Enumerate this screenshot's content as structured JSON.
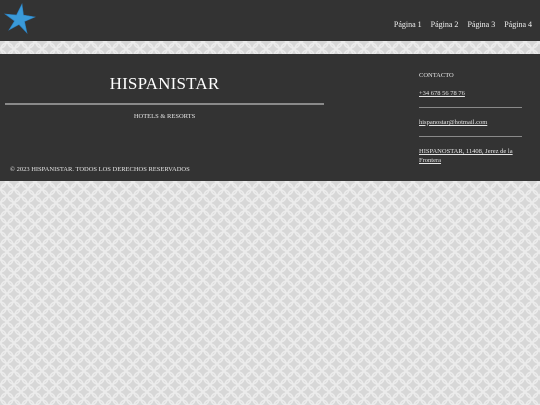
{
  "header": {
    "logo_icon": "blue-star-icon",
    "logo_color": "#3a9ad9",
    "nav": [
      {
        "label": "Página 1"
      },
      {
        "label": "Página 2"
      },
      {
        "label": "Página 3"
      },
      {
        "label": "Página 4"
      }
    ]
  },
  "footer": {
    "brand": {
      "title": "HISPANISTAR",
      "subtitle": "HOTELS & RESORTS"
    },
    "copyright": "© 2023 HISPANISTAR. TODOS LOS DERECHOS RESERVADOS",
    "contact": {
      "title": "CONTACTO",
      "phone": "+34 678 56 78 76",
      "email": "hispanostar@hotmail.com",
      "address": "HISPANOSTAR, 11408, Jerez de la Frontera"
    }
  }
}
